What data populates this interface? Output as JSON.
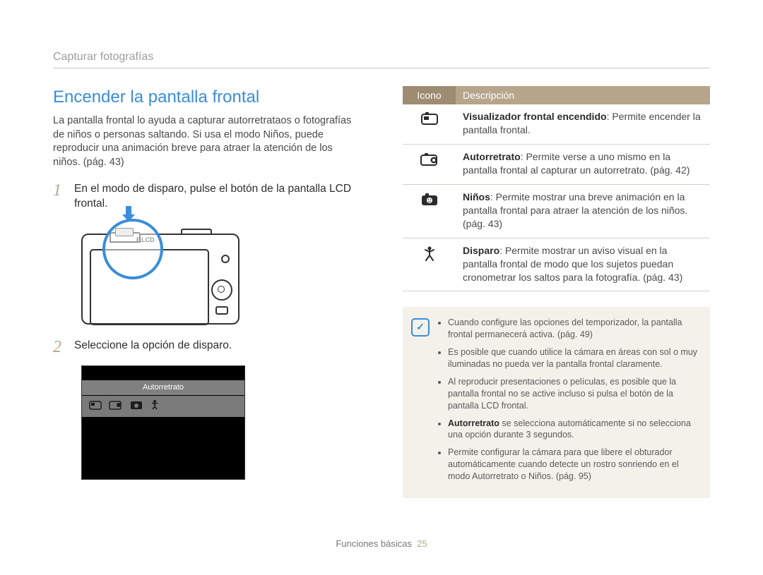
{
  "breadcrumb": "Capturar fotografías",
  "heading": "Encender la pantalla frontal",
  "intro": "La pantalla frontal lo ayuda a capturar autorretrataos o fotografías de niños o personas saltando. Si usa el modo Niños, puede reproducir una animación breve para atraer la atención de los niños. (pág. 43)",
  "steps": [
    {
      "num": "1",
      "text": "En el modo de disparo, pulse el botón de la pantalla LCD frontal."
    },
    {
      "num": "2",
      "text": "Seleccione la opción de disparo."
    }
  ],
  "camera": {
    "flcd_label": "F.LCD"
  },
  "modebar": {
    "label": "Autorretrato"
  },
  "table": {
    "head_icon": "Icono",
    "head_desc": "Descripción",
    "rows": [
      {
        "icon": "front-display-on",
        "bold": "Visualizador frontal encendido",
        "rest": ": Permite encender la pantalla frontal."
      },
      {
        "icon": "self-portrait",
        "bold": "Autorretrato",
        "rest": ": Permite verse a uno mismo en la pantalla frontal al capturar un autorretrato. (pág. 42)"
      },
      {
        "icon": "children",
        "bold": "Niños",
        "rest": ": Permite mostrar una breve animación en la pantalla frontal para atraer la atención de los niños. (pág. 43)"
      },
      {
        "icon": "jump-shot",
        "bold": "Disparo",
        "rest": ": Permite mostrar un aviso visual en la pantalla frontal de modo que los sujetos puedan cronometrar los saltos para la fotografía. (pág. 43)"
      }
    ]
  },
  "notes": [
    "Cuando configure las opciones del temporizador, la pantalla frontal permanecerá activa. (pág. 49)",
    "Es posible que cuando utilice la cámara en áreas con sol o muy iluminadas no pueda ver la pantalla frontal claramente.",
    "Al reproducir presentaciones o películas, es posible que la pantalla frontal no se active incluso si pulsa el botón de la pantalla LCD frontal.",
    "<b>Autorretrato</b> se selecciona automáticamente si no selecciona una opción durante 3 segundos.",
    "Permite configurar la cámara para que libere el obturador automáticamente cuando detecte un rostro sonriendo en el modo Autorretrato o Niños. (pág. 95)"
  ],
  "footer": {
    "section": "Funciones básicas",
    "page": "25"
  }
}
